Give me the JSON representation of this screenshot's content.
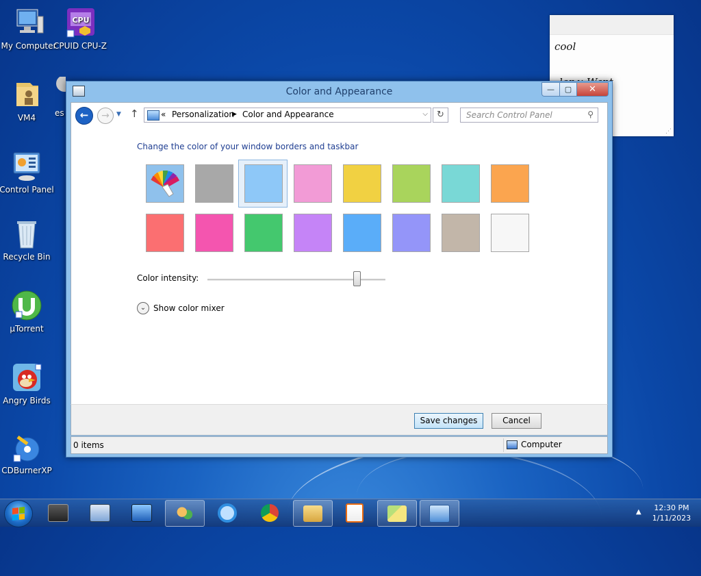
{
  "desktop": {
    "icons": [
      {
        "label": "My Computer"
      },
      {
        "label": "CPUID CPU-Z"
      },
      {
        "label": "VM4"
      },
      {
        "label": "es"
      },
      {
        "label": "Control Panel"
      },
      {
        "label": "Recycle Bin"
      },
      {
        "label": "µTorrent"
      },
      {
        "label": "Angry Birds"
      },
      {
        "label": "CDBurnerXP"
      }
    ],
    "sticky_note": {
      "line1": "cool",
      "line2": "ler u Want"
    }
  },
  "window": {
    "title": "Color and Appearance",
    "caption_buttons": {
      "minimize": "—",
      "maximize": "▢",
      "close": "✕"
    },
    "nav": {
      "breadcrumb_prefix": "«",
      "breadcrumb": [
        "Personalization",
        "Color and Appearance"
      ],
      "search_placeholder": "Search Control Panel"
    },
    "content": {
      "heading": "Change the color of your window borders and taskbar",
      "swatches": [
        {
          "name": "Automatic",
          "color": "#8fc1ec"
        },
        {
          "name": "Gray",
          "color": "#a8a8a8"
        },
        {
          "name": "Sky",
          "color": "#8ec8f8",
          "selected": true
        },
        {
          "name": "Pink",
          "color": "#f29bd6"
        },
        {
          "name": "Yellow",
          "color": "#f1d142"
        },
        {
          "name": "Lime",
          "color": "#a9d45c"
        },
        {
          "name": "Teal",
          "color": "#79d8d6"
        },
        {
          "name": "Orange",
          "color": "#fba54f"
        },
        {
          "name": "Red",
          "color": "#fb6f71"
        },
        {
          "name": "Magenta",
          "color": "#f455af"
        },
        {
          "name": "Green",
          "color": "#44c86e"
        },
        {
          "name": "Violet",
          "color": "#c584f7"
        },
        {
          "name": "Blue",
          "color": "#5aadf9"
        },
        {
          "name": "Periwinkle",
          "color": "#9495f9"
        },
        {
          "name": "Taupe",
          "color": "#c2b6a9"
        },
        {
          "name": "White",
          "color": "#f7f7f7"
        }
      ],
      "intensity_label": "Color intensity:",
      "intensity_value": 0.84,
      "mixer_label": "Show color mixer"
    },
    "footer": {
      "save_label": "Save changes",
      "cancel_label": "Cancel"
    },
    "status": {
      "items": "0 items",
      "location": "Computer"
    }
  },
  "taskbar": {
    "clock_time": "12:30 PM",
    "clock_date": "1/11/2023",
    "tray_arrow": "▲"
  }
}
